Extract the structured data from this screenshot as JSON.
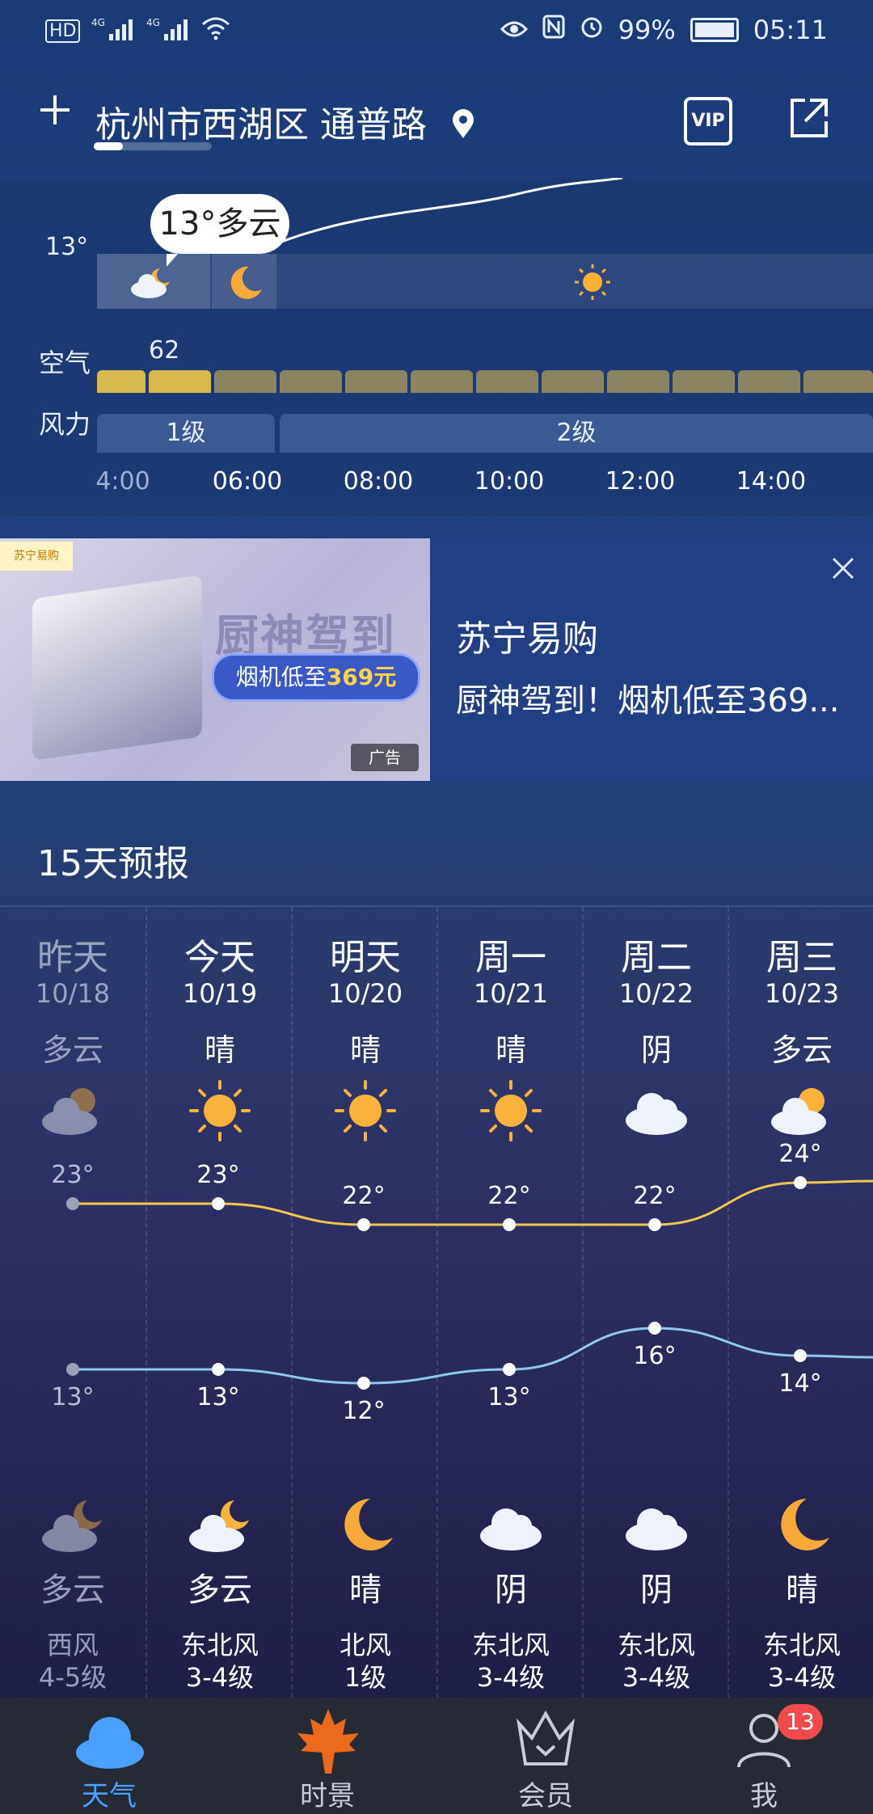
{
  "status_bar": {
    "left": [
      "HD",
      "4G",
      "4G"
    ],
    "battery": "99%",
    "time": "05:11"
  },
  "header": {
    "location": "杭州市西湖区 通普路",
    "vip_label": "VIP"
  },
  "hourly": {
    "current_temp": "13°",
    "tooltip": "13°多云",
    "air_label": "空气",
    "aqi_value": "62",
    "wind_label": "风力",
    "wind_levels": [
      "1级",
      "2级"
    ],
    "times": [
      "4:00",
      "06:00",
      "08:00",
      "10:00",
      "12:00",
      "14:00"
    ]
  },
  "ad": {
    "logo_text": "苏宁易购",
    "headline": "厨神驾到",
    "price_text": "烟机低至",
    "price": "369元",
    "tag": "广告",
    "brand": "苏宁易购",
    "description": "厨神驾到！烟机低至369..."
  },
  "forecast": {
    "title": "15天预报",
    "days": [
      {
        "day": "昨天",
        "date": "10/18",
        "cond_day": "多云",
        "icon_day": "partly-cloudy-icon",
        "high": "23°",
        "low": "13°",
        "icon_night": "cloudy-moon-icon",
        "cond_night": "多云",
        "wind_dir": "西风",
        "wind_level": "4-5级"
      },
      {
        "day": "今天",
        "date": "10/19",
        "cond_day": "晴",
        "icon_day": "sun-icon",
        "high": "23°",
        "low": "13°",
        "icon_night": "cloudy-moon-icon",
        "cond_night": "多云",
        "wind_dir": "东北风",
        "wind_level": "3-4级"
      },
      {
        "day": "明天",
        "date": "10/20",
        "cond_day": "晴",
        "icon_day": "sun-icon",
        "high": "22°",
        "low": "12°",
        "icon_night": "moon-icon",
        "cond_night": "晴",
        "wind_dir": "北风",
        "wind_level": "1级"
      },
      {
        "day": "周一",
        "date": "10/21",
        "cond_day": "晴",
        "icon_day": "sun-icon",
        "high": "22°",
        "low": "13°",
        "icon_night": "cloud-icon",
        "cond_night": "阴",
        "wind_dir": "东北风",
        "wind_level": "3-4级"
      },
      {
        "day": "周二",
        "date": "10/22",
        "cond_day": "阴",
        "icon_day": "cloud-icon",
        "high": "22°",
        "low": "16°",
        "icon_night": "cloud-icon",
        "cond_night": "阴",
        "wind_dir": "东北风",
        "wind_level": "3-4级"
      },
      {
        "day": "周三",
        "date": "10/23",
        "cond_day": "多云",
        "icon_day": "partly-cloudy-icon",
        "high": "24°",
        "low": "14°",
        "icon_night": "moon-icon",
        "cond_night": "晴",
        "wind_dir": "东北风",
        "wind_level": "3-4级"
      }
    ],
    "high_line_color": "#f2c64a",
    "low_line_color": "#8ec8f0"
  },
  "nav": {
    "items": [
      {
        "label": "天气",
        "icon": "cloud-icon"
      },
      {
        "label": "时景",
        "icon": "maple-leaf-icon"
      },
      {
        "label": "会员",
        "icon": "crown-icon"
      },
      {
        "label": "我",
        "icon": "user-icon"
      }
    ],
    "badge": "13"
  }
}
